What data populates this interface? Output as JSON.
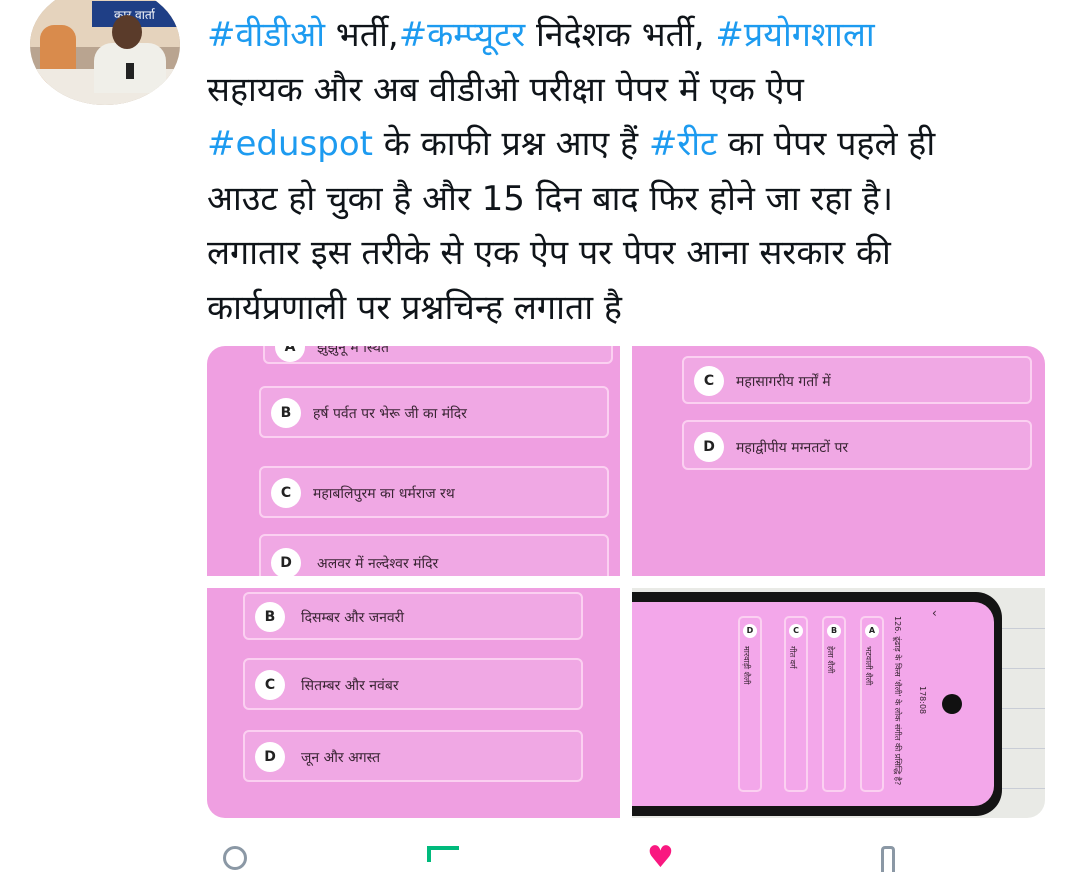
{
  "author": {
    "avatar_banner_text": "कार वार्ता"
  },
  "tweet": {
    "lines": [
      [
        {
          "t": "#वीडीओ",
          "tag": true
        },
        {
          "t": " भर्ती,",
          "tag": false
        },
        {
          "t": "#कम्प्यूटर",
          "tag": true
        },
        {
          "t": " निदेशक भर्ती, ",
          "tag": false
        },
        {
          "t": "#प्रयोगशाला",
          "tag": true
        }
      ],
      [
        {
          "t": "सहायक और अब वीडीओ परीक्षा पेपर में एक ऐप",
          "tag": false
        }
      ],
      [
        {
          "t": "#eduspot",
          "tag": true
        },
        {
          "t": " के काफी प्रश्न  आए हैं ",
          "tag": false
        },
        {
          "t": "#रीट",
          "tag": true
        },
        {
          "t": " का पेपर पहले ही",
          "tag": false
        }
      ],
      [
        {
          "t": "आउट हो चुका है और 15 दिन बाद फिर होने जा रहा है।",
          "tag": false
        }
      ],
      [
        {
          "t": "लगातार इस तरीके से एक ऐप पर पेपर आना सरकार की",
          "tag": false
        }
      ],
      [
        {
          "t": "कार्यप्रणाली पर प्रश्नचिन्ह लगाता है",
          "tag": false
        }
      ]
    ],
    "hashtag_color": "#1d9bf0",
    "text_color": "#0f1419"
  },
  "media": {
    "photo1": {
      "options": [
        {
          "letter": "A",
          "text": "झुंझुनू में स्थित"
        },
        {
          "letter": "B",
          "text": "हर्ष पर्वत पर भेरू जी का  मंदिर"
        },
        {
          "letter": "C",
          "text": "महाबलिपुरम का धर्मराज रथ"
        },
        {
          "letter": "D",
          "text": "अलवर में नल्देश्वर मंदिर"
        }
      ]
    },
    "photo2": {
      "options": [
        {
          "letter": "C",
          "text": "महासागरीय गर्तों में"
        },
        {
          "letter": "D",
          "text": "महाद्वीपीय मग्नतटों पर"
        }
      ]
    },
    "photo3": {
      "options": [
        {
          "letter": "B",
          "text": "दिसम्बर और जनवरी"
        },
        {
          "letter": "C",
          "text": "सितम्बर और नवंबर"
        },
        {
          "letter": "D",
          "text": "जून और अगस्त"
        }
      ]
    },
    "photo4": {
      "question": "126. ढूंढाड़ के किस 'शैली' के लोक संगीत की प्रसिद्धि है?",
      "timer": "178:08",
      "options": [
        {
          "letter": "A",
          "text": "भटवाली शैली"
        },
        {
          "letter": "B",
          "text": "हेला शैली"
        },
        {
          "letter": "C",
          "text": "गीत वर्ग"
        },
        {
          "letter": "D",
          "text": "मारवाड़ी शैली"
        }
      ]
    },
    "tile_color": "#ef9fe1"
  },
  "actions": [
    {
      "name": "reply-icon"
    },
    {
      "name": "retweet-icon"
    },
    {
      "name": "like-icon"
    },
    {
      "name": "share-icon"
    }
  ]
}
